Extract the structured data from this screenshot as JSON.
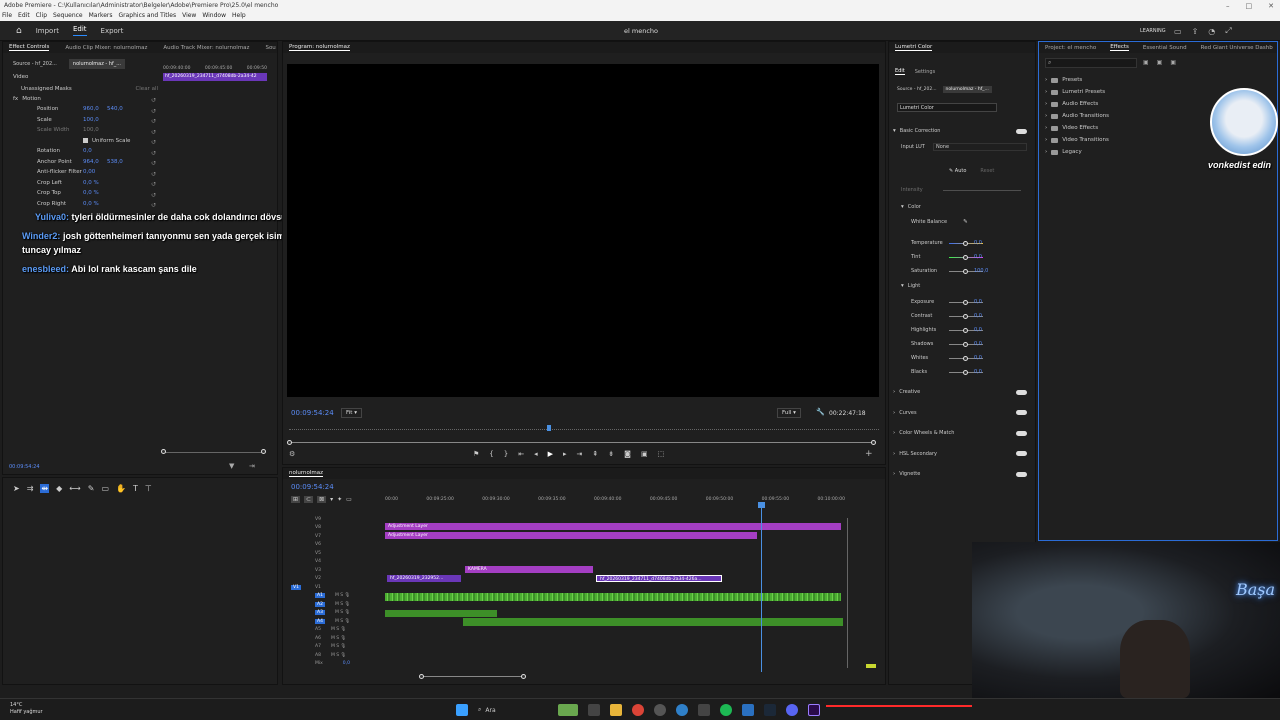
{
  "titlebar": {
    "title": "Adobe Premiere - C:\\Kullanıcılar\\Administrator\\Belgeler\\Adobe\\Premiere Pro\\25.0\\el mencho"
  },
  "menubar": {
    "items": [
      "File",
      "Edit",
      "Clip",
      "Sequence",
      "Markers",
      "Graphics and Titles",
      "View",
      "Window",
      "Help"
    ]
  },
  "header": {
    "nav": [
      "Import",
      "Edit",
      "Export"
    ],
    "project_name": "el mencho",
    "learning": "LEARNING"
  },
  "effect_controls": {
    "tabs": [
      "Effect Controls",
      "Audio Clip Mixer: nolurnolmaz",
      "Audio Track Mixer: nolurnolmaz",
      "Sou"
    ],
    "source_label": "Source - hf_202...",
    "seq_label": "nolurnolmaz - hf_...",
    "ruler_times": [
      "00:09:40:00",
      "00:09:45:00",
      "00:09:50"
    ],
    "clip_name": "hf_20260319_234711_d7408db-2a34-42",
    "video_label": "Video",
    "masks": "Unassigned Masks",
    "clear_all": "Clear all",
    "motion": "Motion",
    "properties": [
      {
        "name": "Position",
        "v1": "960,0",
        "v2": "540,0"
      },
      {
        "name": "Scale",
        "v1": "100,0",
        "v2": ""
      },
      {
        "name": "Scale Width",
        "v1": "100,0",
        "v2": ""
      },
      {
        "name": "Uniform Scale",
        "v1": "",
        "v2": ""
      },
      {
        "name": "Rotation",
        "v1": "0,0",
        "v2": ""
      },
      {
        "name": "Anchor Point",
        "v1": "964,0",
        "v2": "538,0"
      },
      {
        "name": "Anti-flicker Filter",
        "v1": "0,00",
        "v2": ""
      },
      {
        "name": "Crop Left",
        "v1": "0,0 %",
        "v2": ""
      },
      {
        "name": "Crop Top",
        "v1": "0,0 %",
        "v2": ""
      },
      {
        "name": "Crop Right",
        "v1": "0,0 %",
        "v2": ""
      }
    ],
    "bottom_time": "00:09:54:24"
  },
  "chat": [
    {
      "user": "Yuliva0:",
      "msg": "tyleri öldürmesinler de daha cok dolandırıcı dövsün"
    },
    {
      "user": "Winder2:",
      "msg": "josh göttenheimeri tanıyonmu sen yada gerçek isimiyle tuncay yılmaz"
    },
    {
      "user": "enesbleed:",
      "msg": "Abi lol rank kascam şans dile"
    }
  ],
  "program": {
    "tab": "Program: nolurnolmaz",
    "timecode": "00:09:54:24",
    "fit": "Fit",
    "full": "Full",
    "duration": "00:22:47:18",
    "playhead_fraction": 0.44
  },
  "timeline": {
    "sequence_tab": "nolurnolmaz",
    "timecode": "00:09:54:24",
    "ruler": [
      "00:00",
      "00:09:25:00",
      "00:09:30:00",
      "00:09:35:00",
      "00:09:40:00",
      "00:09:45:00",
      "00:09:50:00",
      "00:09:55:00",
      "00:10:00:00"
    ],
    "video_tracks": [
      "V9",
      "V8",
      "V7",
      "V6",
      "V5",
      "V4",
      "V3",
      "V2",
      "V1"
    ],
    "audio_tracks": [
      "A1",
      "A2",
      "A3",
      "A4",
      "A5",
      "A6",
      "A7",
      "A8"
    ],
    "mix_label": "Mix",
    "mix_value": "0,0",
    "clips": {
      "adj1": "Adjustment Layer",
      "adj2": "Adjustment Layer",
      "kamera": "KAMERA",
      "clip_a": "hf_20260319_232952...",
      "clip_b": "hf_20260319_234711_d7408db-2a34-426a..."
    }
  },
  "lumetri": {
    "tab": "Lumetri Color",
    "subtabs": [
      "Edit",
      "Settings"
    ],
    "source_label": "Source - hf_202...",
    "seq_label": "nolurnolmaz - hf_...",
    "effect_select": "Lumetri Color",
    "basic_correction": "Basic Correction",
    "input_lut_label": "Input LUT",
    "input_lut_value": "None",
    "auto": "Auto",
    "reset": "Reset",
    "intensity": "Intensity",
    "color_section": "Color",
    "white_balance": "White Balance",
    "color_sliders": [
      {
        "name": "Temperature",
        "value": "0,0"
      },
      {
        "name": "Tint",
        "value": "0,0"
      },
      {
        "name": "Saturation",
        "value": "100,0"
      }
    ],
    "light_section": "Light",
    "light_sliders": [
      {
        "name": "Exposure",
        "value": "0,0"
      },
      {
        "name": "Contrast",
        "value": "0,0"
      },
      {
        "name": "Highlights",
        "value": "0,0"
      },
      {
        "name": "Shadows",
        "value": "0,0"
      },
      {
        "name": "Whites",
        "value": "0,0"
      },
      {
        "name": "Blacks",
        "value": "0,0"
      }
    ],
    "sections": [
      "Creative",
      "Curves",
      "Color Wheels & Match",
      "HSL Secondary",
      "Vignette"
    ]
  },
  "effects_panel": {
    "tabs": [
      "Project: el mencho",
      "Effects",
      "Essential Sound",
      "Red Giant Universe Dashb"
    ],
    "items": [
      "Presets",
      "Lumetri Presets",
      "Audio Effects",
      "Audio Transitions",
      "Video Effects",
      "Video Transitions",
      "Legacy"
    ]
  },
  "overlay": {
    "avatar_caption": "vonkedist edin",
    "neon_text": "Başa"
  },
  "taskbar": {
    "temp": "14°C",
    "weather": "Hafif yağmur",
    "search_placeholder": "Ara"
  },
  "colors": {
    "accent_blue": "#2b8cff",
    "timecode_blue": "#5b8cf7",
    "clip_purple": "#a43ec3",
    "clip_violet": "#6a37b8",
    "audio_green": "#4caf32"
  }
}
